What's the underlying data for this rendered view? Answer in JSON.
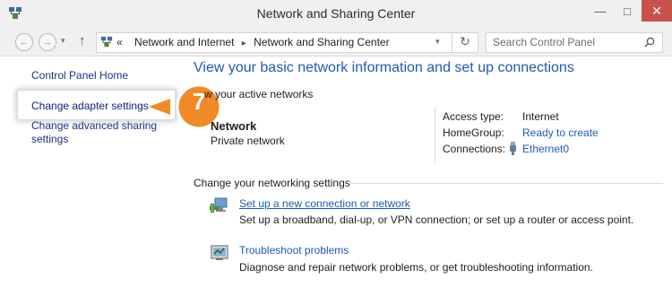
{
  "window": {
    "title": "Network and Sharing Center",
    "close_glyph": "✕",
    "minimize_glyph": "—",
    "maximize_glyph": "□"
  },
  "nav": {
    "back_glyph": "←",
    "forward_glyph": "→",
    "up_glyph": "↑",
    "dropdown_glyph": "▾",
    "refresh_glyph": "↻",
    "breadcrumb": {
      "overflow": "«",
      "items": [
        "Network and Internet",
        "Network and Sharing Center"
      ],
      "separator": "▸"
    },
    "search_placeholder": "Search Control Panel"
  },
  "sidebar": {
    "home": "Control Panel Home",
    "adapter": "Change adapter settings",
    "sharing": "Change advanced sharing settings"
  },
  "callout": {
    "number": "7",
    "color": "#f08a24"
  },
  "main": {
    "heading": "View your basic network information and set up connections",
    "active_networks_label": "w your active networks",
    "network": {
      "name": "Network",
      "type": "Private network"
    },
    "properties": {
      "access_type_label": "Access type:",
      "access_type_value": "Internet",
      "homegroup_label": "HomeGroup:",
      "homegroup_value": "Ready to create",
      "connections_label": "Connections:",
      "connections_value": "Ethernet0"
    },
    "settings_title": "Change your networking settings",
    "tasks": [
      {
        "title": "Set up a new connection or network",
        "desc": "Set up a broadband, dial-up, or VPN connection; or set up a router or access point."
      },
      {
        "title": "Troubleshoot problems",
        "desc": "Diagnose and repair network problems, or get troubleshooting information."
      }
    ]
  },
  "colors": {
    "link": "#1e5ab4",
    "close_button": "#c7514b",
    "accent_callout": "#f08a24"
  }
}
